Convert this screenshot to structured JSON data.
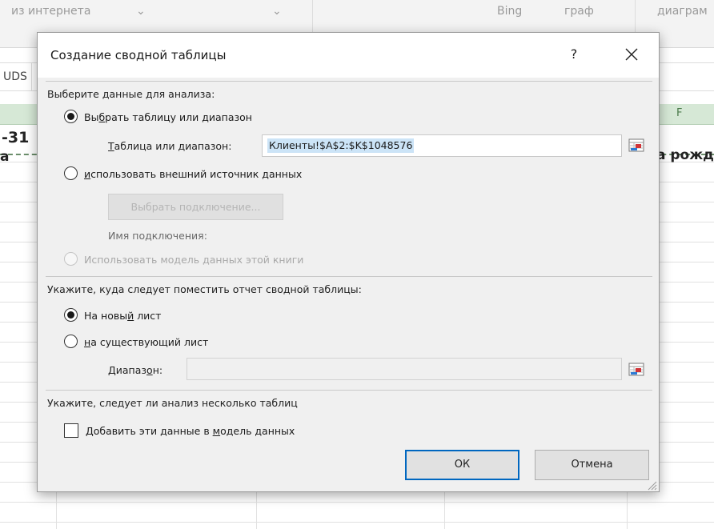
{
  "excel": {
    "ribbon": {
      "items": [
        "из интернета",
        "Bing",
        "граф",
        "диаграм"
      ]
    },
    "name_box": "UDS",
    "column_f_header": "F",
    "cells": {
      "row_num_partial": "-31",
      "col_a_partial": "а",
      "col_f_partial": "а рожд"
    }
  },
  "dialog": {
    "title": "Создание сводной таблицы",
    "help_label": "?",
    "section_data": "Выберите данные для анализа:",
    "option_table": {
      "pre": "Вы",
      "accel": "б",
      "post": "рать таблицу или диапазон",
      "checked": true
    },
    "table_range": {
      "label_accel": "Т",
      "label_rest": "аблица или диапазон:",
      "value": "Клиенты!$A$2:$K$1048576"
    },
    "option_external": {
      "accel": "и",
      "post": "спользовать внешний источник данных",
      "checked": false
    },
    "choose_connection_label": "Выбрать подключение...",
    "connection_name_label": "Имя подключения:",
    "option_model": {
      "label": "Использовать модель данных этой книги",
      "disabled": true
    },
    "section_location": "Укажите, куда следует поместить отчет сводной таблицы:",
    "option_new_sheet": {
      "pre": "На новы",
      "accel": "й",
      "post": " лист",
      "checked": true
    },
    "option_existing_sheet": {
      "accel": "н",
      "post": "а существующий лист",
      "checked": false
    },
    "location_range": {
      "label_pre": "Диапаз",
      "label_accel": "о",
      "label_post": "н:",
      "value": ""
    },
    "section_multiple": "Укажите, следует ли анализ несколько таблиц",
    "add_to_model": {
      "pre": "Добавить эти данные в ",
      "accel": "м",
      "post": "одель данных",
      "checked": false
    },
    "ok_label": "ОК",
    "cancel_label": "Отмена"
  },
  "colors": {
    "accent": "#0067c0",
    "excel_green_header": "#d6e8d6",
    "selection": "#cce4f7"
  }
}
